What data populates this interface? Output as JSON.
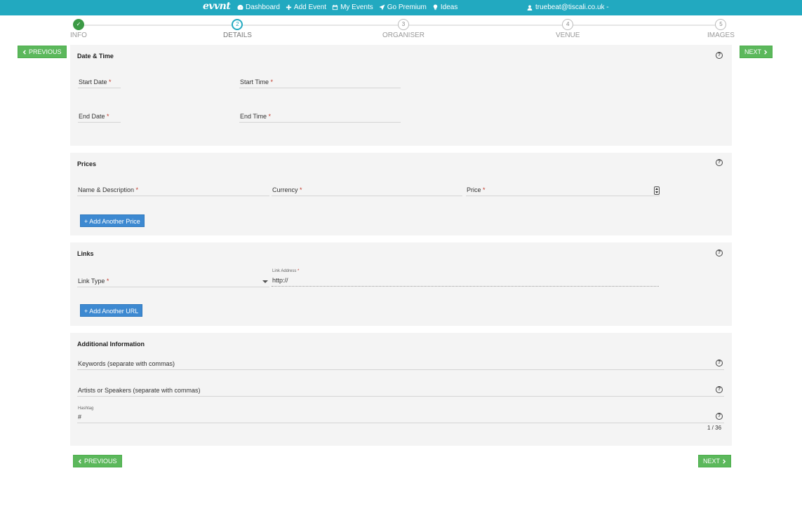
{
  "nav": {
    "logo": "evvnt",
    "links": [
      "Dashboard",
      "Add Event",
      "My Events",
      "Go Premium",
      "Ideas"
    ],
    "user": "truebeat@tiscali.co.uk -"
  },
  "steps": [
    {
      "number": "✓",
      "label": "INFO",
      "state": "done"
    },
    {
      "number": "2",
      "label": "DETAILS",
      "state": "active"
    },
    {
      "number": "3",
      "label": "ORGANISER",
      "state": "todo"
    },
    {
      "number": "4",
      "label": "VENUE",
      "state": "todo"
    },
    {
      "number": "5",
      "label": "IMAGES",
      "state": "todo"
    }
  ],
  "buttons": {
    "previous": "PREVIOUS",
    "next": "NEXT",
    "add_price": "+ Add Another Price",
    "add_url": "+ Add Another URL"
  },
  "date_time": {
    "title": "Date & Time",
    "start_date": "Start Date",
    "start_time": "Start Time",
    "end_date": "End Date",
    "end_time": "End Time"
  },
  "prices": {
    "title": "Prices",
    "name_desc": "Name & Description",
    "currency": "Currency",
    "price": "Price"
  },
  "links": {
    "title": "Links",
    "link_type": "Link Type",
    "link_address_label": "Link Address",
    "link_address_value": "http://"
  },
  "additional": {
    "title": "Additional Information",
    "keywords": "Keywords (separate with commas)",
    "artists": "Artists or Speakers (separate with commas)",
    "hashtag_label": "Hashtag",
    "hashtag_value": "#",
    "hashtag_counter": "1 / 36"
  },
  "required_mark": "*",
  "help_glyph": "?",
  "colors": {
    "nav_bg": "#22a9c0",
    "success": "#5cb85c",
    "primary": "#3d89d1",
    "panel_bg": "#f4f4f4"
  }
}
